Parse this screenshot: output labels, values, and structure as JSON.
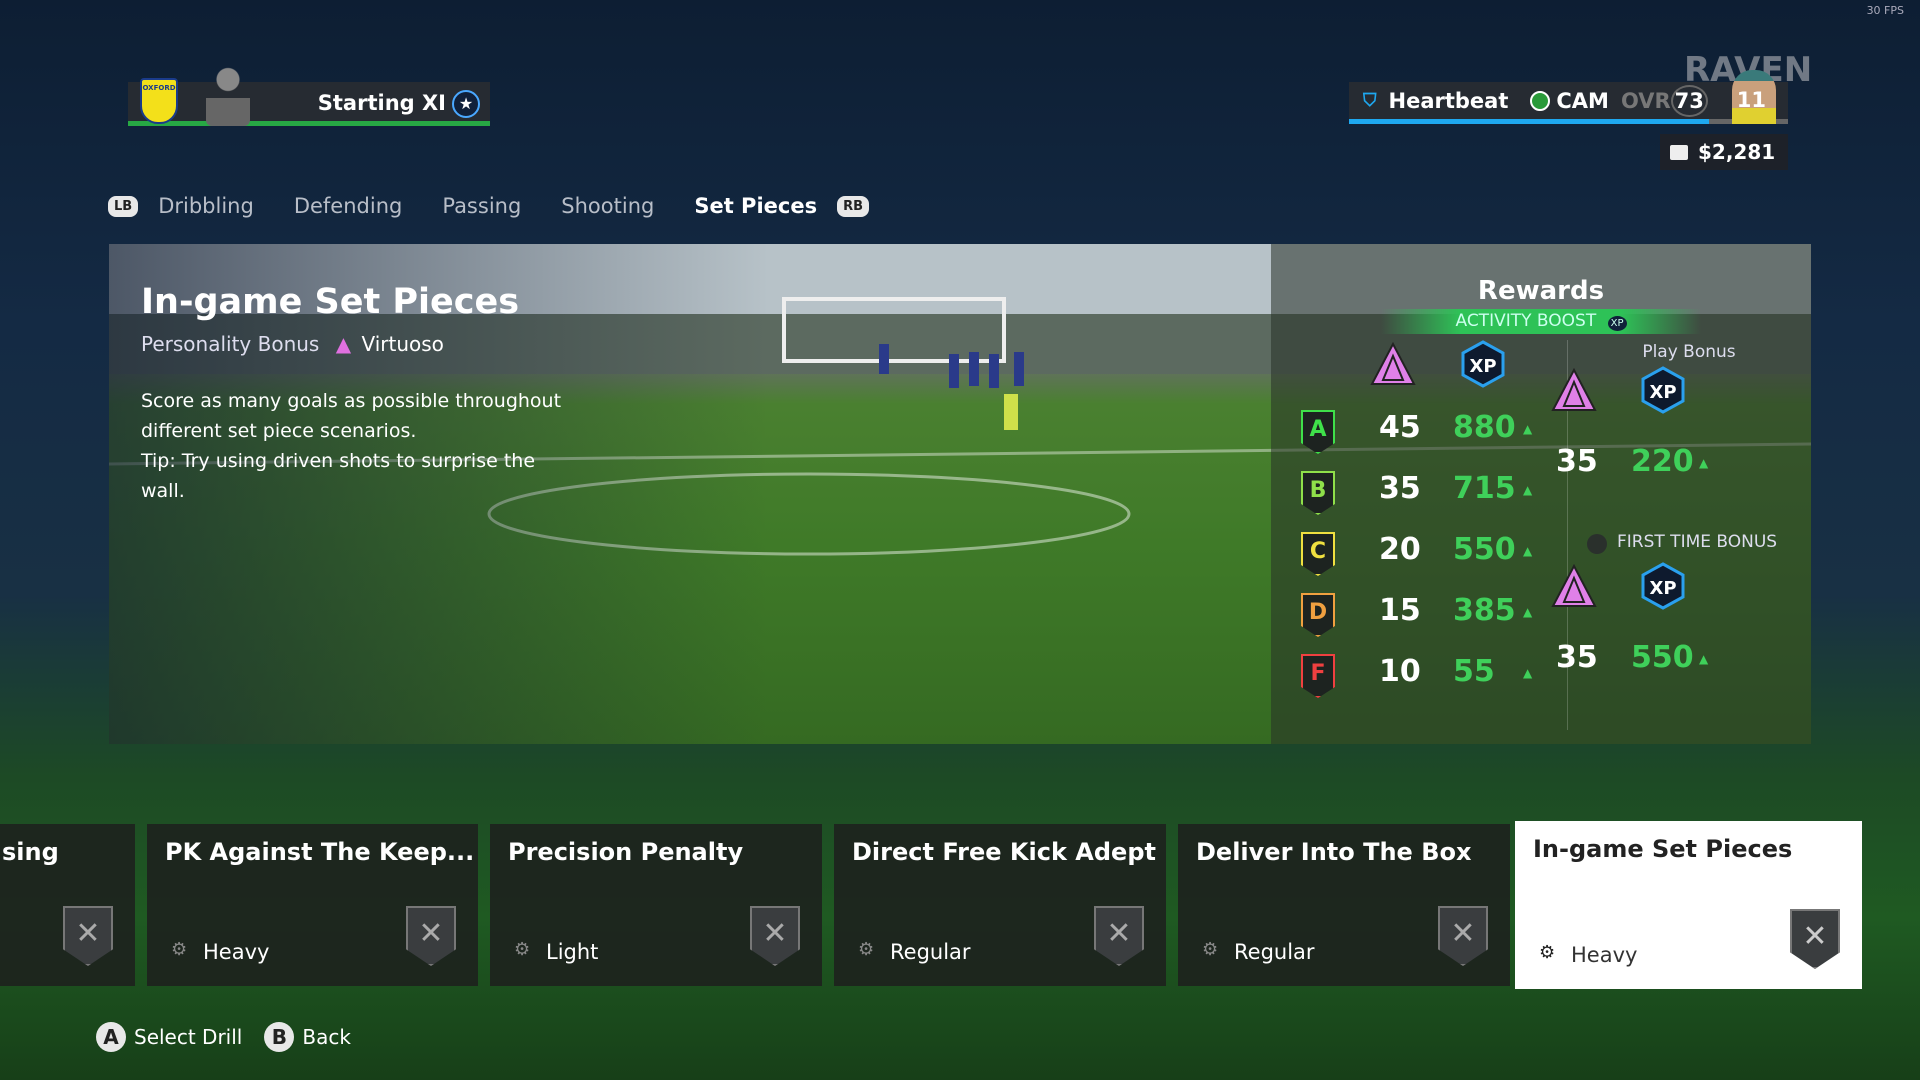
{
  "fps": "30 FPS",
  "club": {
    "crest_text": "OXFORD",
    "squad_label": "Starting XI"
  },
  "tabs": {
    "left_button": "LB",
    "right_button": "RB",
    "items": [
      "Dribbling",
      "Defending",
      "Passing",
      "Shooting",
      "Set Pieces"
    ],
    "active": "Set Pieces"
  },
  "player": {
    "archetype": "Heartbeat",
    "position": "CAM",
    "ovr_label": "OVR",
    "ovr": "73",
    "number": "11",
    "name": "RAVEN",
    "xp_progress_pct": 82,
    "wallet": "$2,281"
  },
  "drill": {
    "title": "In-game Set Pieces",
    "personality_label": "Personality Bonus",
    "personality": "Virtuoso",
    "description": "Score as many goals as possible throughout different set piece scenarios.",
    "tip": "Tip: Try using driven shots to surprise the wall."
  },
  "rewards": {
    "title": "Rewards",
    "activity_boost": "ACTIVITY BOOST",
    "xp_badge": "XP",
    "grades": [
      {
        "grade": "A",
        "points": "45",
        "xp": "880",
        "color": "#3fe04a"
      },
      {
        "grade": "B",
        "points": "35",
        "xp": "715",
        "color": "#8fe04a"
      },
      {
        "grade": "C",
        "points": "20",
        "xp": "550",
        "color": "#f0e040"
      },
      {
        "grade": "D",
        "points": "15",
        "xp": "385",
        "color": "#f0a040"
      },
      {
        "grade": "F",
        "points": "10",
        "xp": "55",
        "color": "#f04040"
      }
    ],
    "play_bonus": {
      "label": "Play Bonus",
      "points": "35",
      "xp": "220"
    },
    "first_time_bonus": {
      "label": "FIRST TIME BONUS",
      "points": "35",
      "xp": "550"
    }
  },
  "cards": [
    {
      "title": "sing",
      "intensity": ""
    },
    {
      "title": "PK Against The Keep...",
      "intensity": "Heavy"
    },
    {
      "title": "Precision Penalty",
      "intensity": "Light"
    },
    {
      "title": "Direct Free Kick Adept",
      "intensity": "Regular"
    },
    {
      "title": "Deliver Into The Box",
      "intensity": "Regular"
    },
    {
      "title": "In-game Set Pieces",
      "intensity": "Heavy",
      "selected": true
    }
  ],
  "hints": [
    {
      "button": "A",
      "label": "Select Drill"
    },
    {
      "button": "B",
      "label": "Back"
    }
  ],
  "colors": {
    "accent_green": "#3fd05a",
    "xp_blue": "#1ea8f0",
    "personality_pink": "#e070e0"
  }
}
